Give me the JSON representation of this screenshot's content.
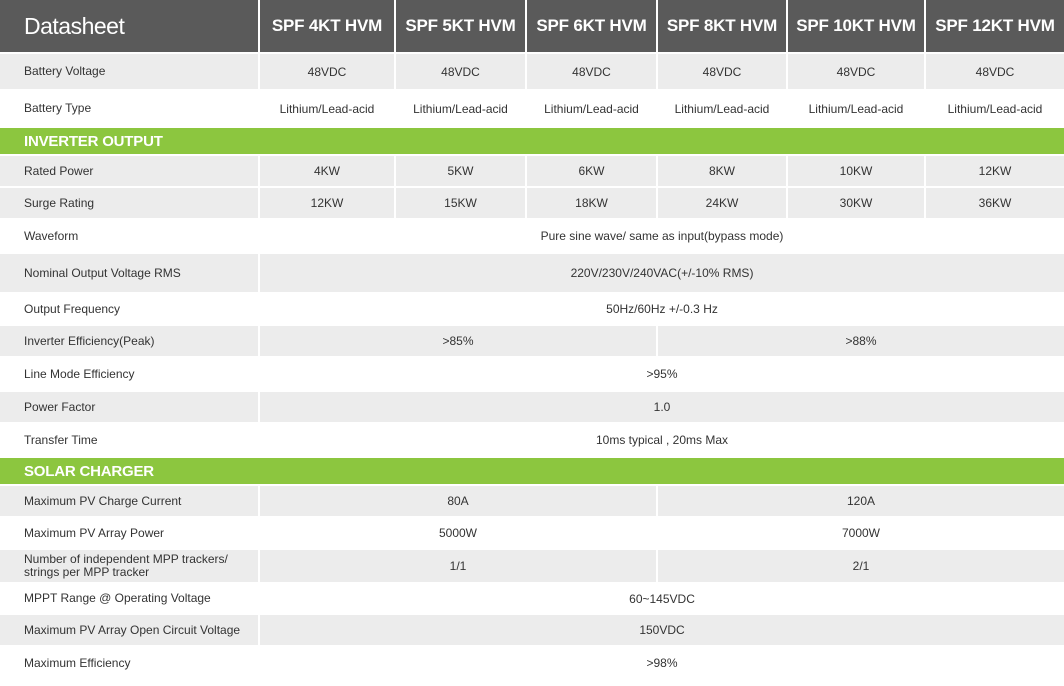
{
  "header": {
    "title": "Datasheet",
    "models": [
      "SPF 4KT HVM",
      "SPF 5KT HVM",
      "SPF 6KT HVM",
      "SPF 8KT HVM",
      "SPF 10KT HVM",
      "SPF 12KT HVM"
    ]
  },
  "general": {
    "battery_voltage": {
      "label": "Battery Voltage",
      "values": [
        "48VDC",
        "48VDC",
        "48VDC",
        "48VDC",
        "48VDC",
        "48VDC"
      ]
    },
    "battery_type": {
      "label": "Battery Type",
      "values": [
        "Lithium/Lead-acid",
        "Lithium/Lead-acid",
        "Lithium/Lead-acid",
        "Lithium/Lead-acid",
        "Lithium/Lead-acid",
        "Lithium/Lead-acid"
      ]
    }
  },
  "inverter_output": {
    "section_title": "INVERTER OUTPUT",
    "rated_power": {
      "label": "Rated Power",
      "values": [
        "4KW",
        "5KW",
        "6KW",
        "8KW",
        "10KW",
        "12KW"
      ]
    },
    "surge_rating": {
      "label": "Surge Rating",
      "values": [
        "12KW",
        "15KW",
        "18KW",
        "24KW",
        "30KW",
        "36KW"
      ]
    },
    "waveform": {
      "label": "Waveform",
      "value": "Pure sine wave/ same as input(bypass mode)"
    },
    "nominal_voltage": {
      "label": "Nominal Output Voltage RMS",
      "value": "220V/230V/240VAC(+/-10% RMS)"
    },
    "output_frequency": {
      "label": "Output Frequency",
      "value": "50Hz/60Hz +/-0.3 Hz"
    },
    "inverter_efficiency": {
      "label": "Inverter Efficiency(Peak)",
      "values": [
        ">85%",
        ">88%"
      ]
    },
    "line_mode_efficiency": {
      "label": "Line Mode Efficiency",
      "value": ">95%"
    },
    "power_factor": {
      "label": "Power Factor",
      "value": "1.0"
    },
    "transfer_time": {
      "label": "Transfer Time",
      "value": "10ms typical , 20ms Max"
    }
  },
  "solar_charger": {
    "section_title": "SOLAR CHARGER",
    "max_pv_current": {
      "label": "Maximum PV Charge Current",
      "values": [
        "80A",
        "120A"
      ]
    },
    "max_pv_power": {
      "label": "Maximum PV Array Power",
      "values": [
        "5000W",
        "7000W"
      ]
    },
    "mpp_trackers": {
      "label": "Number of independent MPP trackers/ strings per MPP tracker",
      "values": [
        "1/1",
        "2/1"
      ]
    },
    "mppt_range": {
      "label": "MPPT Range @ Operating Voltage",
      "value": "60~145VDC"
    },
    "max_open_circuit": {
      "label": "Maximum PV Array Open Circuit Voltage",
      "value": "150VDC"
    },
    "max_efficiency": {
      "label": "Maximum Efficiency",
      "value": ">98%"
    }
  }
}
